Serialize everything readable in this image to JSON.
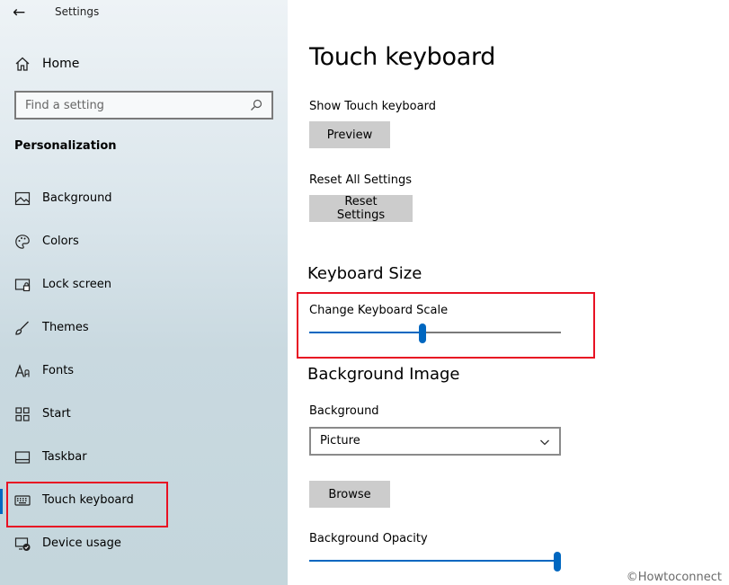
{
  "window": {
    "title": "Settings"
  },
  "sidebar": {
    "home_label": "Home",
    "search_placeholder": "Find a setting",
    "section_title": "Personalization",
    "items": [
      {
        "label": "Background",
        "icon": "image-icon"
      },
      {
        "label": "Colors",
        "icon": "palette-icon"
      },
      {
        "label": "Lock screen",
        "icon": "lock-screen-icon"
      },
      {
        "label": "Themes",
        "icon": "brush-icon"
      },
      {
        "label": "Fonts",
        "icon": "font-icon"
      },
      {
        "label": "Start",
        "icon": "start-grid-icon"
      },
      {
        "label": "Taskbar",
        "icon": "taskbar-icon"
      },
      {
        "label": "Touch keyboard",
        "icon": "keyboard-icon",
        "selected": true
      },
      {
        "label": "Device usage",
        "icon": "device-usage-icon"
      }
    ]
  },
  "main": {
    "page_title": "Touch keyboard",
    "show_label": "Show Touch keyboard",
    "preview_button": "Preview",
    "reset_label": "Reset All Settings",
    "reset_button": "Reset Settings",
    "keyboard_size_title": "Keyboard Size",
    "scale_label": "Change Keyboard Scale",
    "scale_value": 0.45,
    "background_image_title": "Background Image",
    "background_label": "Background",
    "background_value": "Picture",
    "browse_button": "Browse",
    "opacity_label": "Background Opacity",
    "opacity_value": 1.0
  },
  "watermark": "©Howtoconnect",
  "colors": {
    "accent": "#0067c0",
    "highlight_box": "#e81123",
    "button_bg": "#cccccc"
  }
}
